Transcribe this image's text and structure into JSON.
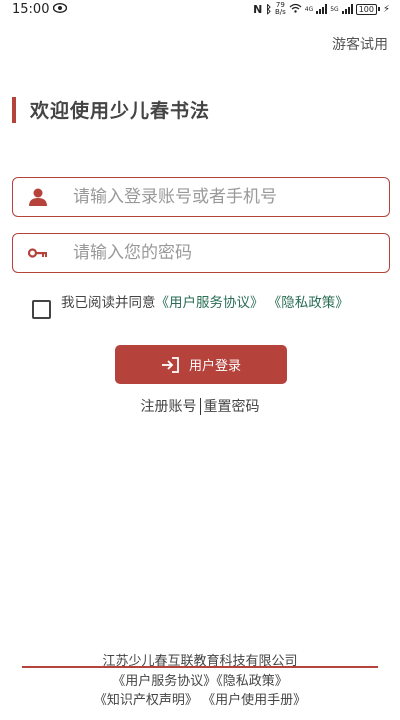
{
  "status_bar": {
    "time": "15:00",
    "net_speed_value": "79",
    "net_speed_unit": "B/s",
    "signal1_label": "4G",
    "signal2_label": "5G",
    "battery": "100"
  },
  "header": {
    "guest_label": "游客试用"
  },
  "welcome": {
    "title": "欢迎使用少儿春书法"
  },
  "form": {
    "account_placeholder": "请输入登录账号或者手机号",
    "password_placeholder": "请输入您的密码",
    "agree_prefix": "我已阅读并同意",
    "agree_link1": "《用户服务协议》",
    "agree_link2": "《隐私政策》",
    "login_label": "用户登录",
    "register_label": "注册账号",
    "reset_label": "重置密码"
  },
  "footer": {
    "company": "江苏少儿春互联教育科技有限公司",
    "service_agreement": "《用户服务协议》",
    "privacy_policy": "《隐私政策》",
    "ip_statement": "《知识产权声明》",
    "user_manual": "《用户使用手册》"
  },
  "colors": {
    "accent": "#b5433c",
    "link": "#2a6e55"
  },
  "icons": {
    "account": "user-icon",
    "password": "key-icon",
    "login": "login-arrow-icon"
  }
}
